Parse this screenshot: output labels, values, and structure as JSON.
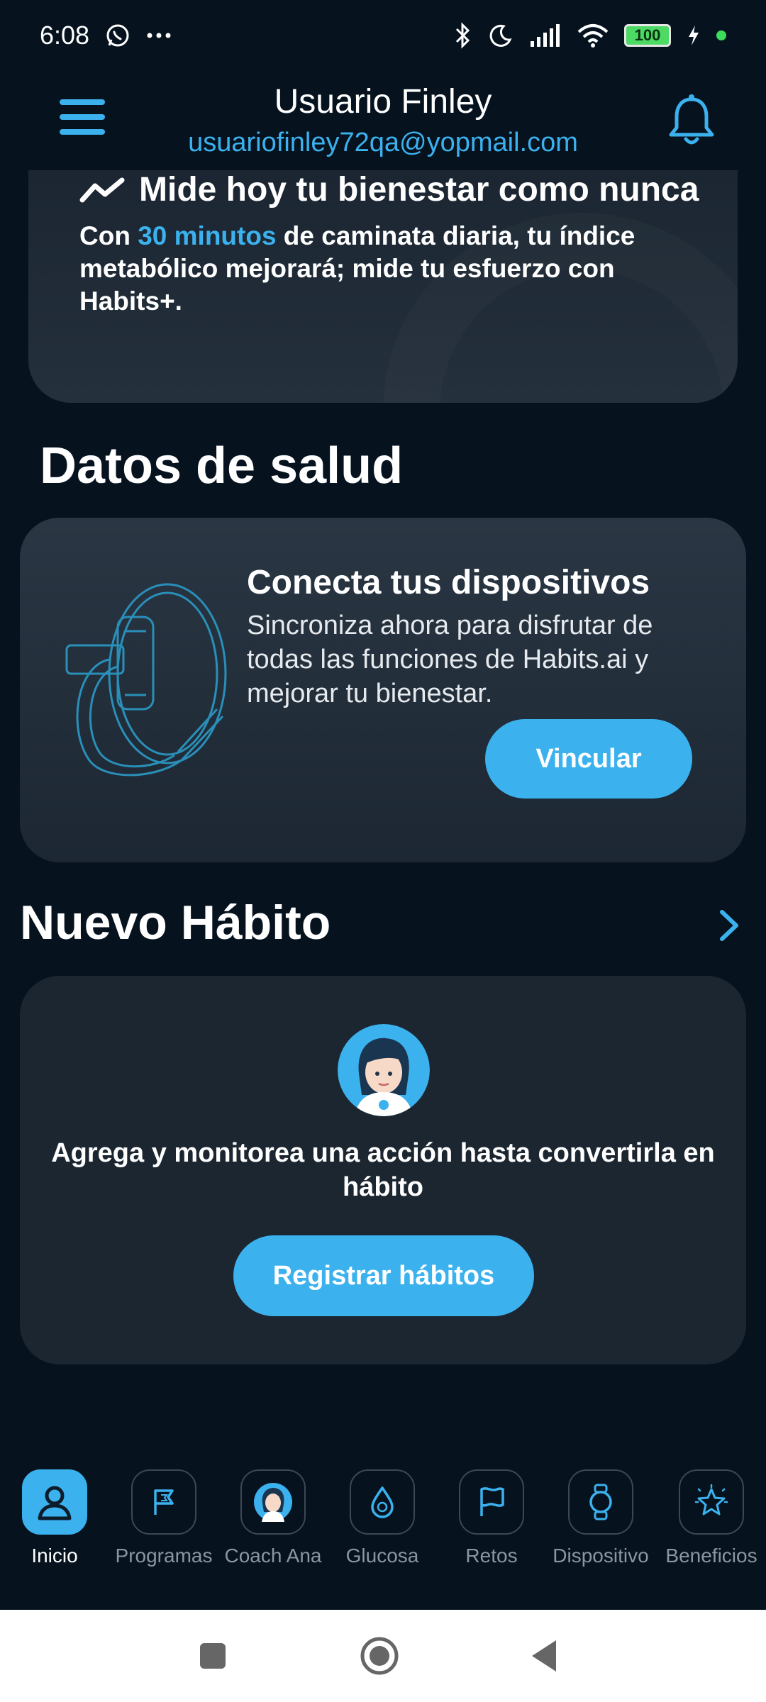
{
  "status_bar": {
    "time": "6:08",
    "icons": [
      "whatsapp-icon",
      "more-icon",
      "bluetooth-icon",
      "moon-icon",
      "signal-icon",
      "wifi-icon",
      "battery-icon",
      "charging-icon"
    ],
    "battery": "100"
  },
  "header": {
    "user_name": "Usuario Finley",
    "email": "usuariofinley72qa@yopmail.com"
  },
  "wellness": {
    "title": "Mide hoy tu bienestar como nunca",
    "text_prefix": "Con ",
    "text_highlight": "30 minutos",
    "text_suffix": " de caminata diaria, tu índice metabólico mejorará; mide tu esfuerzo con Habits+."
  },
  "health": {
    "section_title": "Datos de salud",
    "card_title": "Conecta tus dispositivos",
    "card_text": "Sincroniza ahora para disfrutar de todas las funciones de Habits.ai y mejorar tu bienestar.",
    "button": "Vincular"
  },
  "habit": {
    "section_title": "Nuevo Hábito",
    "text": "Agrega y monitorea una acción hasta convertirla en hábito",
    "button": "Registrar hábitos"
  },
  "nav": {
    "items": [
      {
        "label": "Inicio",
        "icon": "user-icon",
        "active": true
      },
      {
        "label": "Programas",
        "icon": "flag-icon",
        "active": false
      },
      {
        "label": "Coach Ana",
        "icon": "coach-avatar-icon",
        "active": false
      },
      {
        "label": "Glucosa",
        "icon": "drop-icon",
        "active": false
      },
      {
        "label": "Retos",
        "icon": "flag-outline-icon",
        "active": false
      },
      {
        "label": "Dispositivo",
        "icon": "watch-icon",
        "active": false
      },
      {
        "label": "Beneficios",
        "icon": "star-badge-icon",
        "active": false
      }
    ]
  },
  "colors": {
    "background": "#06131f",
    "accent": "#3bb1ee",
    "card": "#1c2631"
  }
}
